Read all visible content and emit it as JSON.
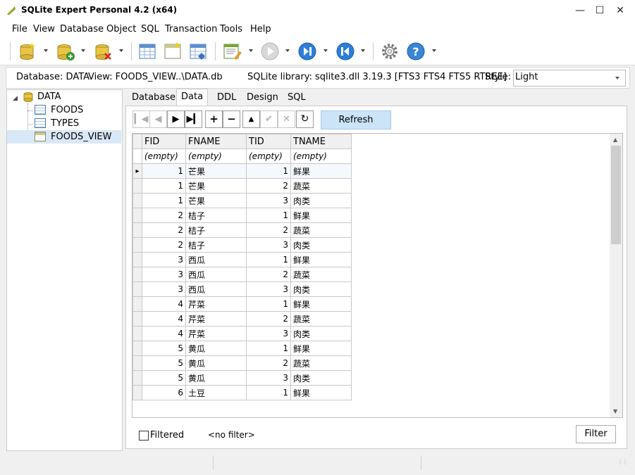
{
  "window": {
    "title": "SQLite Expert Personal 4.2 (x64)"
  },
  "menu": [
    "File",
    "View",
    "Database",
    "Object",
    "SQL",
    "Transaction",
    "Tools",
    "Help"
  ],
  "infobar": {
    "database": "Database: DATA",
    "view": "View: FOODS_VIEW",
    "path": "...\\DATA.db",
    "library": "SQLite library: sqlite3.dll 3.19.3 [FTS3 FTS4 FTS5 RTREE]",
    "style_label": "Style:",
    "style_value": "Light"
  },
  "tree": {
    "root": "DATA",
    "items": [
      "FOODS",
      "TYPES",
      "FOODS_VIEW"
    ]
  },
  "tabs": [
    "Database",
    "Data",
    "DDL",
    "Design",
    "SQL"
  ],
  "navigator": {
    "refresh_label": "Refresh"
  },
  "grid": {
    "columns": [
      "FID",
      "FNAME",
      "TID",
      "TNAME"
    ],
    "filter_placeholder": "(empty)",
    "rows": [
      [
        "1",
        "芒果",
        "1",
        "鲜果"
      ],
      [
        "1",
        "芒果",
        "2",
        "蔬菜"
      ],
      [
        "1",
        "芒果",
        "3",
        "肉类"
      ],
      [
        "2",
        "桔子",
        "1",
        "鲜果"
      ],
      [
        "2",
        "桔子",
        "2",
        "蔬菜"
      ],
      [
        "2",
        "桔子",
        "3",
        "肉类"
      ],
      [
        "3",
        "西瓜",
        "1",
        "鲜果"
      ],
      [
        "3",
        "西瓜",
        "2",
        "蔬菜"
      ],
      [
        "3",
        "西瓜",
        "3",
        "肉类"
      ],
      [
        "4",
        "芹菜",
        "1",
        "鲜果"
      ],
      [
        "4",
        "芹菜",
        "2",
        "蔬菜"
      ],
      [
        "4",
        "芹菜",
        "3",
        "肉类"
      ],
      [
        "5",
        "黄瓜",
        "1",
        "鲜果"
      ],
      [
        "5",
        "黄瓜",
        "2",
        "蔬菜"
      ],
      [
        "5",
        "黄瓜",
        "3",
        "肉类"
      ],
      [
        "6",
        "土豆",
        "1",
        "鲜果"
      ]
    ]
  },
  "bottom": {
    "filtered_label": "Filtered",
    "filter_text": "<no filter>",
    "filter_button": "Filter"
  },
  "colors": {
    "accent": "#cce4f7",
    "selection": "#d9e8f6"
  }
}
